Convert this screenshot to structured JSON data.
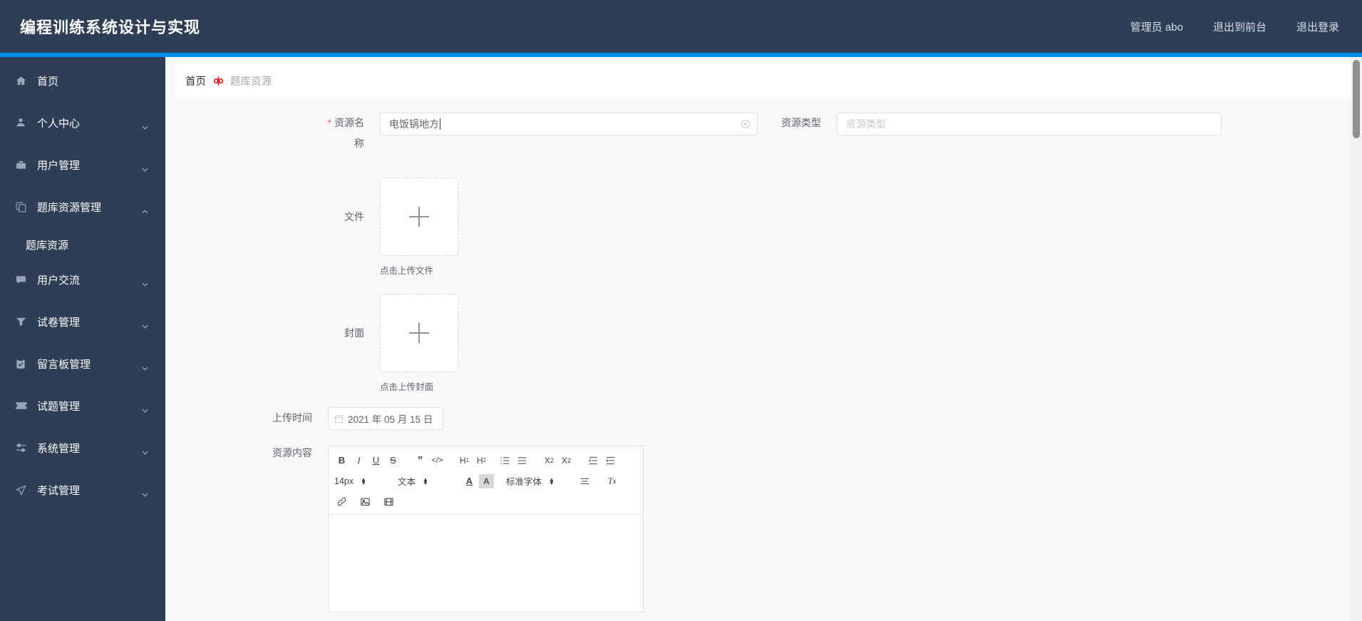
{
  "header": {
    "title": "编程训练系统设计与实现",
    "accent_color": "#008cf0",
    "bg_color": "#2d3e55",
    "right_items": [
      {
        "label": "管理员 abo",
        "name": "admin-user"
      },
      {
        "label": "退出到前台",
        "name": "exit-to-frontend"
      },
      {
        "label": "退出登录",
        "name": "logout"
      }
    ]
  },
  "sidebar": {
    "items": [
      {
        "label": "首页",
        "icon": "home-icon",
        "expandable": false
      },
      {
        "label": "个人中心",
        "icon": "user-icon",
        "expandable": true,
        "expanded": false
      },
      {
        "label": "用户管理",
        "icon": "briefcase-icon",
        "expandable": true,
        "expanded": false
      },
      {
        "label": "题库资源管理",
        "icon": "copy-icon",
        "expandable": true,
        "expanded": true
      },
      {
        "label": "用户交流",
        "icon": "chat-icon",
        "expandable": true,
        "expanded": false
      },
      {
        "label": "试卷管理",
        "icon": "funnel-icon",
        "expandable": true,
        "expanded": false
      },
      {
        "label": "留言板管理",
        "icon": "clipboard-icon",
        "expandable": true,
        "expanded": false
      },
      {
        "label": "试题管理",
        "icon": "ticket-icon",
        "expandable": true,
        "expanded": false
      },
      {
        "label": "系统管理",
        "icon": "sliders-icon",
        "expandable": true,
        "expanded": false
      },
      {
        "label": "考试管理",
        "icon": "send-icon",
        "expandable": true,
        "expanded": false
      }
    ],
    "submenu": {
      "parent_index": 3,
      "label": "题库资源"
    }
  },
  "breadcrumb": {
    "home": "首页",
    "separator_icon": "red-flower-icon",
    "current": "题库资源"
  },
  "form": {
    "resource_name": {
      "label": "资源名称",
      "required": true,
      "value": "电饭锅地方",
      "placeholder": "资源名称",
      "clear_icon": "circle-close-icon",
      "has_caret": true
    },
    "resource_type": {
      "label": "资源类型",
      "required": false,
      "value": "",
      "placeholder": "资源类型"
    },
    "file_upload": {
      "label": "文件",
      "plus_icon": "plus-icon",
      "tip": "点击上传文件"
    },
    "cover_upload": {
      "label": "封面",
      "plus_icon": "plus-icon",
      "tip": "点击上传封面"
    },
    "upload_time": {
      "label": "上传时间",
      "calendar_icon": "calendar-icon",
      "value": "2021 年 05 月 15 日"
    },
    "resource_content": {
      "label": "资源内容",
      "editor": {
        "row1": [
          {
            "glyph": "B",
            "name": "bold-icon"
          },
          {
            "glyph": "I",
            "name": "italic-icon"
          },
          {
            "glyph": "U",
            "name": "underline-icon"
          },
          {
            "glyph": "S",
            "name": "strikethrough-icon"
          },
          {
            "glyph": "❞",
            "name": "blockquote-icon"
          },
          {
            "glyph": "</>",
            "name": "code-icon"
          },
          {
            "glyph": "H1",
            "name": "heading1-icon"
          },
          {
            "glyph": "H2",
            "name": "heading2-icon"
          },
          {
            "glyph": "list-ol",
            "name": "ordered-list-icon"
          },
          {
            "glyph": "list-ul",
            "name": "unordered-list-icon"
          },
          {
            "glyph": "X₂",
            "name": "subscript-icon"
          },
          {
            "glyph": "X²",
            "name": "superscript-icon"
          },
          {
            "glyph": "outdent",
            "name": "outdent-icon"
          },
          {
            "glyph": "indent",
            "name": "indent-icon"
          }
        ],
        "font_size": "14px",
        "block_type": "文本",
        "color_icon": "font-color-icon",
        "bgcolor_icon": "background-color-icon",
        "font_family": "标准字体",
        "align_icon": "align-icon",
        "clear_format_icon": "clear-format-icon",
        "row3": [
          {
            "glyph": "link",
            "name": "link-icon"
          },
          {
            "glyph": "image",
            "name": "image-icon"
          },
          {
            "glyph": "video",
            "name": "video-icon"
          }
        ],
        "body_value": ""
      }
    }
  }
}
